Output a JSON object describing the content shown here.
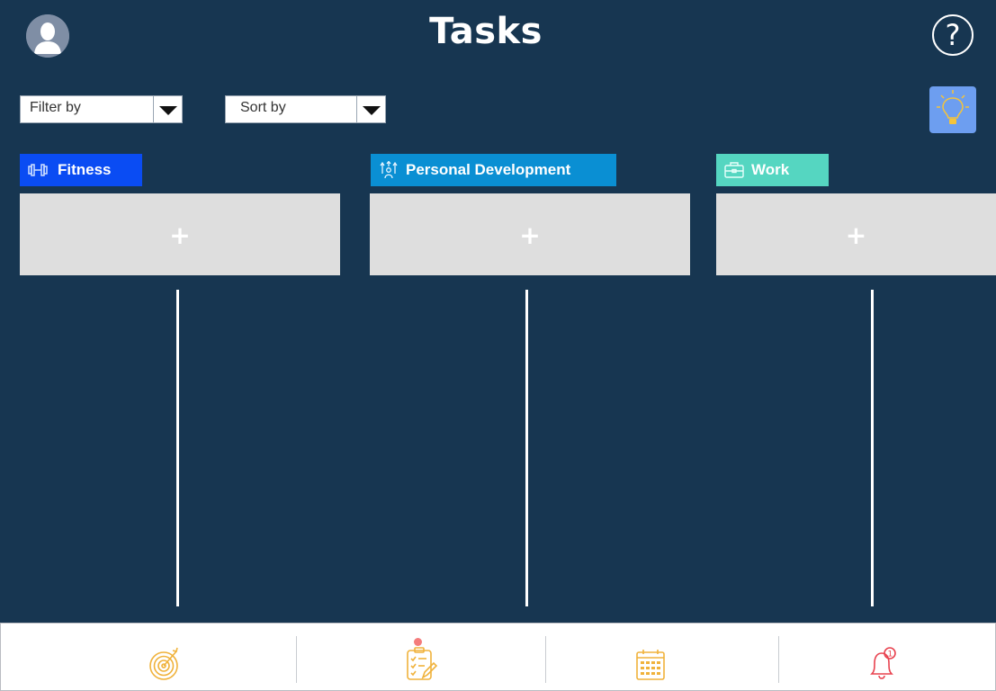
{
  "header": {
    "title": "Tasks"
  },
  "toolbar": {
    "filter_label": "Filter by",
    "sort_label": "Sort by"
  },
  "columns": [
    {
      "name": "Fitness",
      "color": "#0a4cf3",
      "icon": "dumbbell-icon",
      "add_label": "+"
    },
    {
      "name": "Personal Development",
      "color": "#0a8fd3",
      "icon": "growth-person-icon",
      "add_label": "+"
    },
    {
      "name": "Work",
      "color": "#55d6c1",
      "icon": "briefcase-icon",
      "add_label": "+"
    }
  ],
  "help_label": "?",
  "bottom_nav": [
    {
      "icon": "target-icon",
      "color": "#f0b23b"
    },
    {
      "icon": "task-checklist-icon",
      "color": "#f0b23b",
      "active_dot": "#f47c7c"
    },
    {
      "icon": "calendar-icon",
      "color": "#f0b23b"
    },
    {
      "icon": "notification-bell-icon",
      "color": "#e8424f",
      "badge": "1"
    }
  ],
  "colors": {
    "background": "#173651",
    "tips_button": "#6d9ef0"
  }
}
